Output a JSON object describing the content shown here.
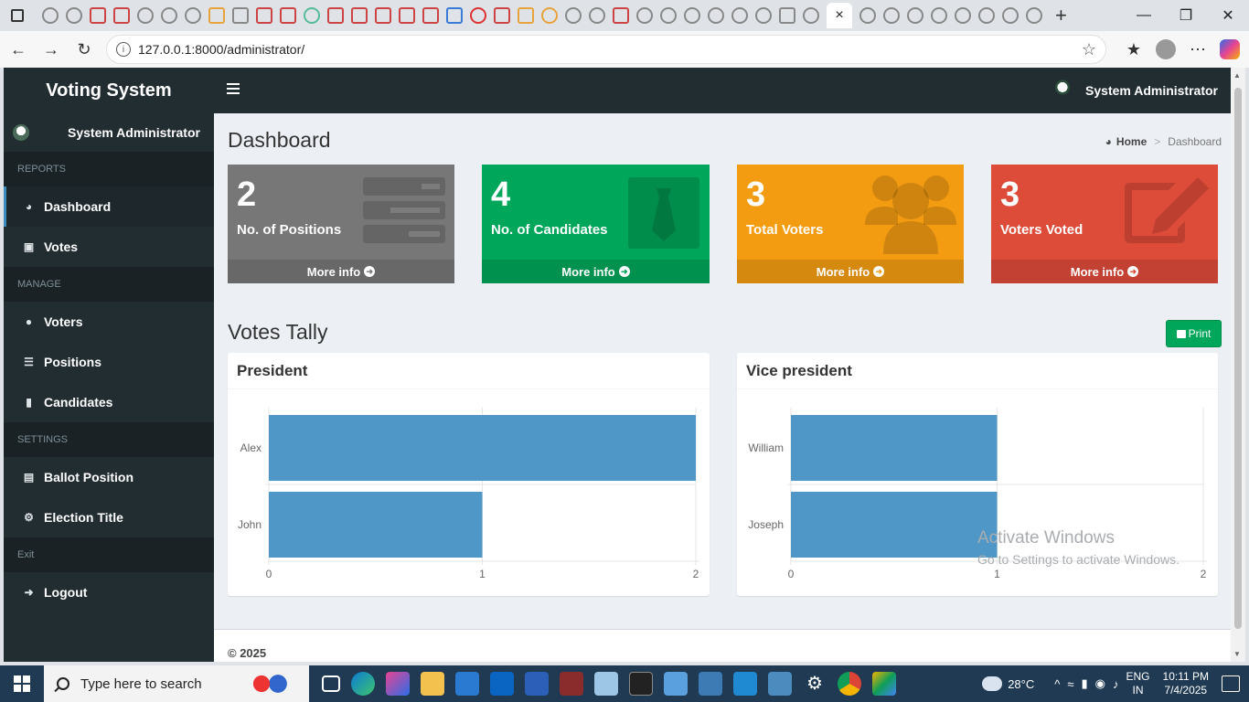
{
  "browser": {
    "url": "127.0.0.1:8000/administrator/",
    "active_tab_close": "×"
  },
  "app": {
    "logo": "Voting System",
    "top_user": "System Administrator"
  },
  "sidebar": {
    "user_name": "System Administrator",
    "avatar_alt": "User",
    "sections": [
      {
        "header": "REPORTS",
        "items": [
          {
            "label": "Dashboard",
            "icon": "dashboard-icon",
            "active": true
          },
          {
            "label": "Votes",
            "icon": "lock-icon"
          }
        ]
      },
      {
        "header": "MANAGE",
        "items": [
          {
            "label": "Voters",
            "icon": "users-icon"
          },
          {
            "label": "Positions",
            "icon": "list-icon"
          },
          {
            "label": "Candidates",
            "icon": "id-badge-icon"
          }
        ]
      },
      {
        "header": "SETTINGS",
        "items": [
          {
            "label": "Ballot Position",
            "icon": "file-icon"
          },
          {
            "label": "Election Title",
            "icon": "gear-icon"
          }
        ]
      },
      {
        "header": "Exit",
        "items": [
          {
            "label": "Logout",
            "icon": "arrow-left-icon"
          }
        ]
      }
    ]
  },
  "header": {
    "title": "Dashboard",
    "breadcrumb": {
      "home": "Home",
      "current": "Dashboard"
    }
  },
  "stats": [
    {
      "value": "2",
      "label": "No. of Positions",
      "more": "More info",
      "color": "#777777",
      "icon": "list-icon"
    },
    {
      "value": "4",
      "label": "No. of Candidates",
      "more": "More info",
      "color": "#00a65a",
      "icon": "id-badge-icon"
    },
    {
      "value": "3",
      "label": "Total Voters",
      "more": "More info",
      "color": "#f39c12",
      "icon": "users-icon"
    },
    {
      "value": "3",
      "label": "Voters Voted",
      "more": "More info",
      "color": "#dd4b39",
      "icon": "edit-icon"
    }
  ],
  "tally": {
    "title": "Votes Tally",
    "print_label": "Print"
  },
  "chart_data": [
    {
      "type": "bar",
      "orientation": "horizontal",
      "title": "President",
      "categories": [
        "Alex",
        "John"
      ],
      "values": [
        2,
        1
      ],
      "xlim": [
        0,
        2
      ],
      "ticks": [
        0,
        1,
        2
      ],
      "color": "#4e97c7"
    },
    {
      "type": "bar",
      "orientation": "horizontal",
      "title": "Vice president",
      "categories": [
        "William",
        "Joseph"
      ],
      "values": [
        1,
        1
      ],
      "xlim": [
        0,
        2
      ],
      "ticks": [
        0,
        1,
        2
      ],
      "color": "#4e97c7"
    }
  ],
  "footer": {
    "copyright": "© 2025"
  },
  "watermark": {
    "line1": "Activate Windows",
    "line2": "Go to Settings to activate Windows."
  },
  "taskbar": {
    "search_placeholder": "Type here to search",
    "temperature": "28°C",
    "lang1": "ENG",
    "lang2": "IN",
    "time": "10:11 PM",
    "date": "7/4/2025"
  }
}
